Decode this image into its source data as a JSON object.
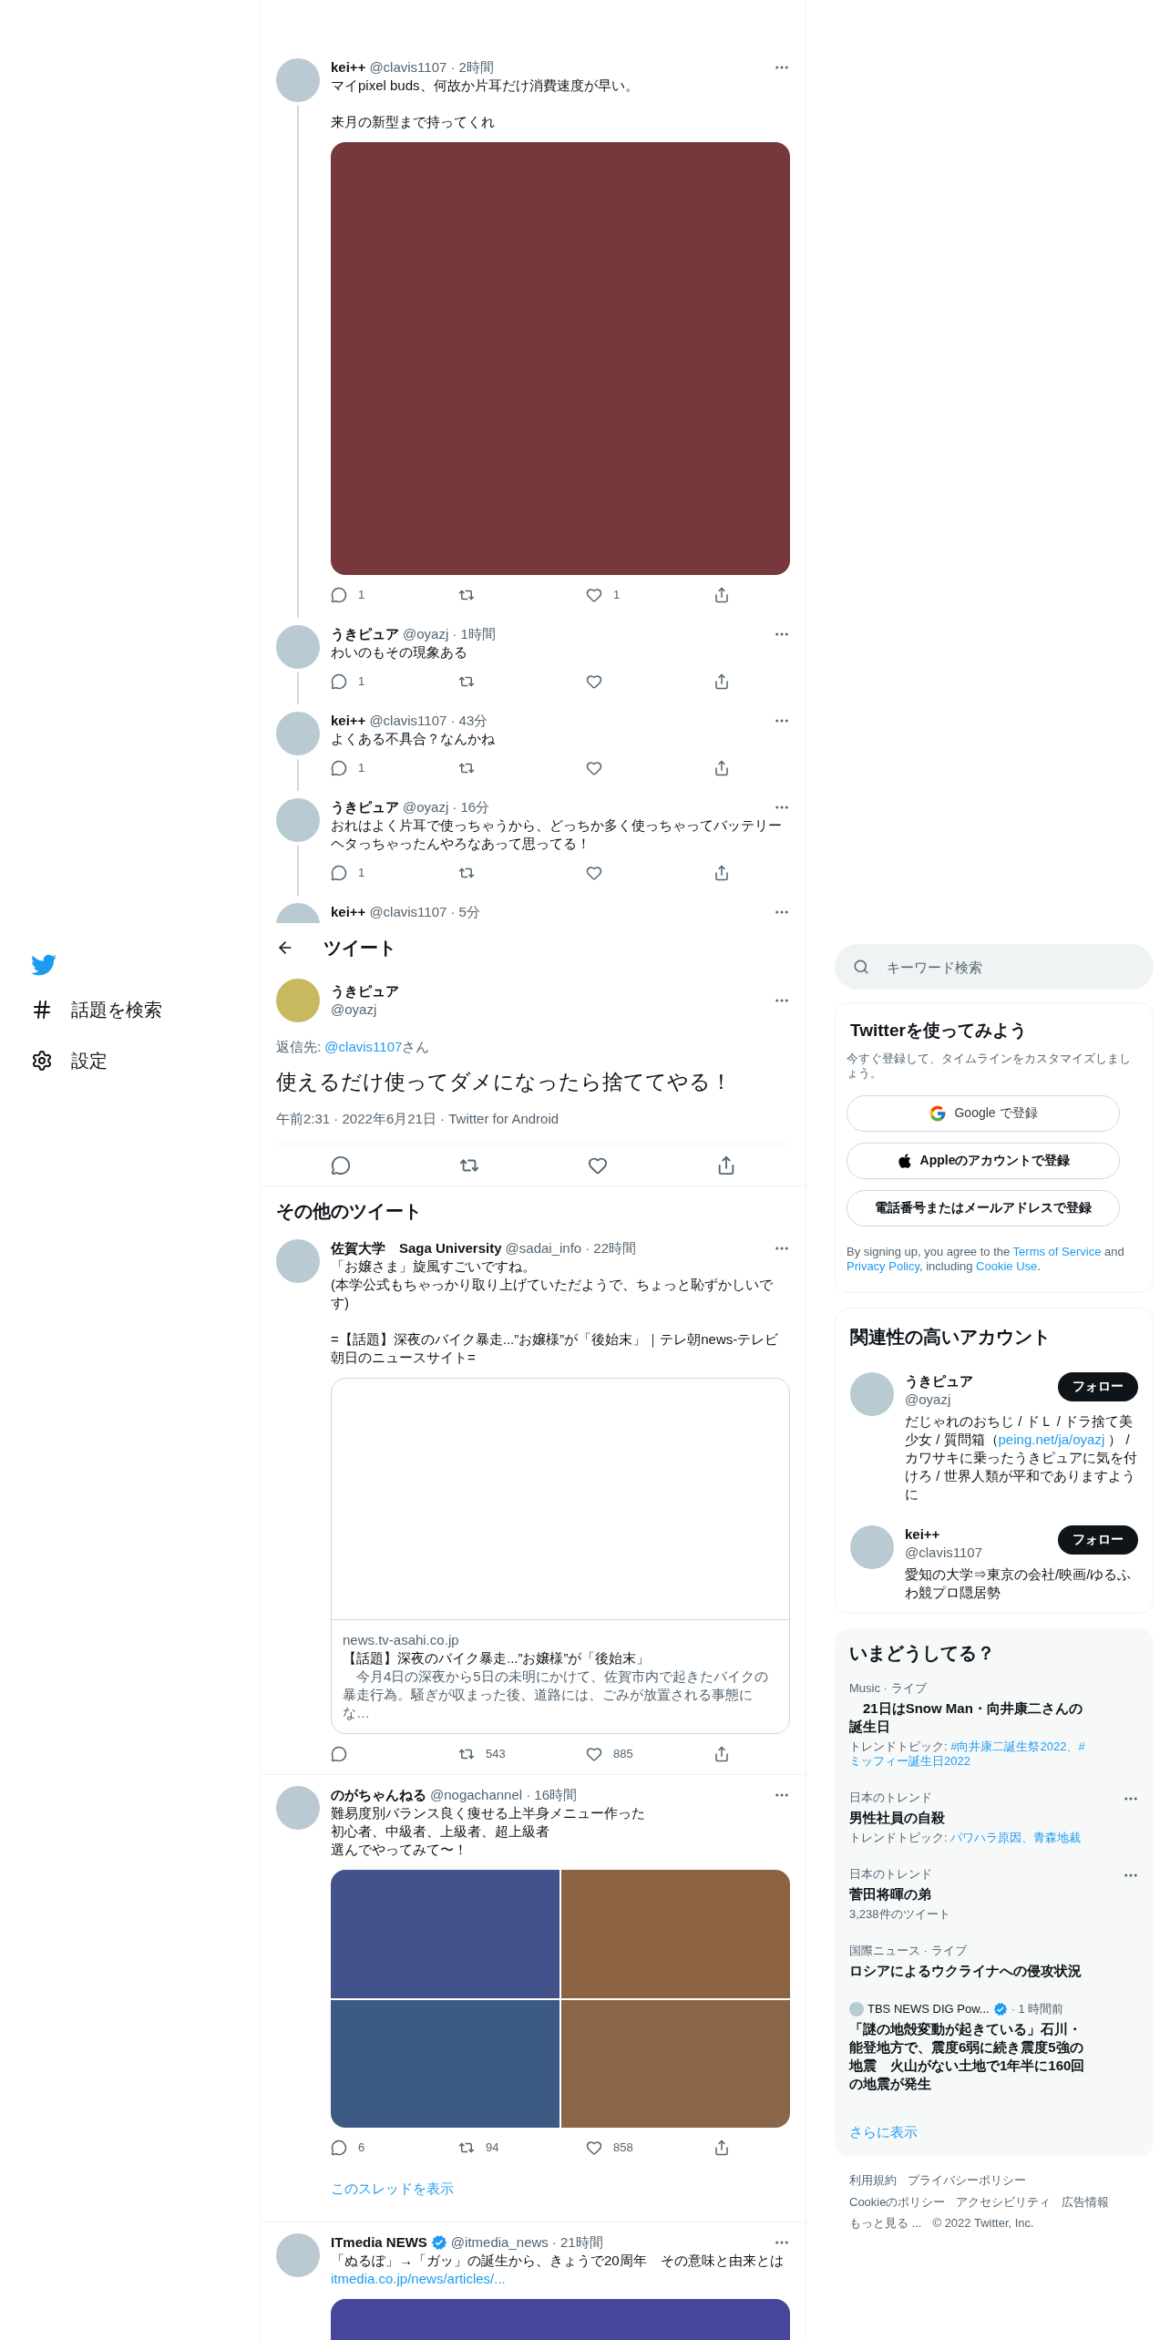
{
  "sidebar": {
    "items": [
      {
        "kind": "explore",
        "label": "話題を検索"
      },
      {
        "kind": "settings",
        "label": "設定"
      }
    ]
  },
  "thread": [
    {
      "name": "kei++",
      "handle": "@clavis1107",
      "time": "· 2時間",
      "paragraphs": [
        [
          "マイpixel buds、何故か片耳だけ消費速度が早い。"
        ],
        [
          "来月の新型まで持ってくれ"
        ]
      ],
      "media": {
        "kind": "single"
      },
      "stats": {
        "reply": "1",
        "like": "1"
      }
    },
    {
      "name": "うきピュア",
      "handle": "@oyazj",
      "time": "· 1時間",
      "paragraphs": [
        [
          "わいのもその現象ある"
        ]
      ],
      "stats": {
        "reply": "1"
      }
    },
    {
      "name": "kei++",
      "handle": "@clavis1107",
      "time": "· 43分",
      "paragraphs": [
        [
          "よくある不具合？なんかね"
        ]
      ],
      "stats": {
        "reply": "1"
      }
    },
    {
      "name": "うきピュア",
      "handle": "@oyazj",
      "time": "· 16分",
      "paragraphs": [
        [
          "おれはよく片耳で使っちゃうから、どっちか多く使っちゃってバッテリーヘタっちゃったんやろなあって思ってる！"
        ]
      ],
      "stats": {
        "reply": "1"
      }
    },
    {
      "name": "kei++",
      "handle": "@clavis1107",
      "time": "· 5分"
    }
  ],
  "focus": {
    "header": "ツイート",
    "name": "うきピュア",
    "handle": "@oyazj",
    "reply_prefix": "返信先: ",
    "reply_to": "@clavis1107",
    "reply_suffix": "さん",
    "text": "使えるだけ使ってダメになったら捨ててやる！",
    "meta": "午前2:31 · 2022年6月21日 · Twitter for Android"
  },
  "more_tweets": {
    "title": "その他のツイート",
    "tweets": [
      {
        "name": "佐賀大学　Saga University",
        "verified": false,
        "handle": "@sadai_info",
        "time": "· 22時間",
        "paragraphs": [
          [
            "「お嬢さま」旋風すごいですね。",
            "(本学公式もちゃっかり取り上げていただようで、ちょっと恥ずかしいです)"
          ],
          [
            "=【話題】深夜のバイク暴走...”お嬢様”が「後始末」｜テレ朝news-テレビ朝日のニュースサイト="
          ]
        ],
        "card": {
          "domain": "news.tv-asahi.co.jp",
          "title": "【話題】深夜のバイク暴走...”お嬢様”が「後始末」",
          "description": "　今月4日の深夜から5日の未明にかけて、佐賀市内で起きたバイクの暴走行為。騒ぎが収まった後、道路には、ごみが放置される事態にな…"
        },
        "stats": {
          "retweet": "543",
          "like": "885"
        }
      },
      {
        "name": "のがちゃんねる",
        "verified": false,
        "handle": "@nogachannel",
        "time": "· 16時間",
        "paragraphs": [
          [
            "難易度別バランス良く痩せる上半身メニュー作った",
            "初心者、中級者、上級者、超上級者",
            "選んでやってみて〜！"
          ]
        ],
        "media": {
          "kind": "grid"
        },
        "stats": {
          "reply": "6",
          "retweet": "94",
          "like": "858"
        },
        "show_thread": "このスレッドを表示"
      },
      {
        "name": "ITmedia NEWS",
        "verified": true,
        "handle": "@itmedia_news",
        "time": "· 21時間",
        "paragraphs": [
          [
            "「ぬるぽ」→「ガッ」の誕生から、きょうで20周年　その意味と由来とは"
          ]
        ],
        "link": "itmedia.co.jp/news/articles/...",
        "media": {
          "kind": "banner"
        }
      }
    ]
  },
  "search": {
    "placeholder": "キーワード検索"
  },
  "signup": {
    "title": "Twitterを使ってみよう",
    "subtitle": "今すぐ登録して、タイムラインをカスタマイズしましょう。",
    "buttons": [
      {
        "kind": "google",
        "label": "Google で登録"
      },
      {
        "kind": "apple",
        "label": "Appleのアカウントで登録"
      },
      {
        "kind": "phone",
        "label": "電話番号またはメールアドレスで登録"
      }
    ],
    "terms": [
      {
        "text": "By signing up, you agree to the ",
        "link": false
      },
      {
        "text": "Terms of Service",
        "link": true
      },
      {
        "text": " and ",
        "link": false
      },
      {
        "text": "Privacy Policy",
        "link": true
      },
      {
        "text": ", including ",
        "link": false
      },
      {
        "text": "Cookie Use",
        "link": true
      },
      {
        "text": ".",
        "link": false
      }
    ]
  },
  "accounts": {
    "title": "関連性の高いアカウント",
    "items": [
      {
        "name": "うきピュア",
        "handle": "@oyazj",
        "follow": "フォロー",
        "bio": [
          {
            "text": "だじゃれのおちじ / ドＬ / ドラ捨て美少女 / 質問箱（",
            "link": false
          },
          {
            "text": "peing.net/ja/oyazj",
            "link": true
          },
          {
            "text": " ） / カワサキに乗ったうきピュアに気を付けろ / 世界人類が平和でありますように",
            "link": false
          }
        ]
      },
      {
        "name": "kei++",
        "handle": "@clavis1107",
        "follow": "フォロー",
        "bio": [
          {
            "text": "愛知の大学⇒東京の会社/映画/ゆるふわ競プロ隠居勢",
            "link": false
          }
        ]
      }
    ]
  },
  "trends": {
    "title": "いまどうしてる？",
    "items": [
      {
        "kind": "trend",
        "category": "Music · ライブ",
        "title": "　21日はSnow Man・向井康二さんの誕生日",
        "topics_prefix": "トレンドトピック: ",
        "topics": "#向井康二誕生祭2022、#ミッフィー誕生日2022",
        "more": false
      },
      {
        "kind": "trend",
        "category": "日本のトレンド",
        "title": "男性社員の自殺",
        "topics_prefix": "トレンドトピック: ",
        "topics": "パワハラ原因、青森地裁",
        "more": true
      },
      {
        "kind": "trend",
        "category": "日本のトレンド",
        "title": "菅田将暉の弟",
        "count": "3,238件のツイート",
        "more": true
      },
      {
        "kind": "trend",
        "category": "国際ニュース · ライブ",
        "title": "ロシアによるウクライナへの侵攻状況",
        "more": false
      },
      {
        "kind": "news",
        "source": "TBS NEWS DIG Pow...",
        "verified": true,
        "time": "· 1 時間前",
        "title": "「謎の地殻変動が起きている」石川・能登地方で、震度6弱に続き震度5強の地震　火山がない土地で1年半に160回の地震が発生",
        "more": false
      }
    ],
    "show_more": "さらに表示"
  },
  "footer": {
    "links": [
      "利用規約",
      "プライバシーポリシー",
      "Cookieのポリシー",
      "アクセシビリティ",
      "広告情報",
      "もっと見る ..."
    ],
    "copyright": "© 2022 Twitter, Inc."
  }
}
